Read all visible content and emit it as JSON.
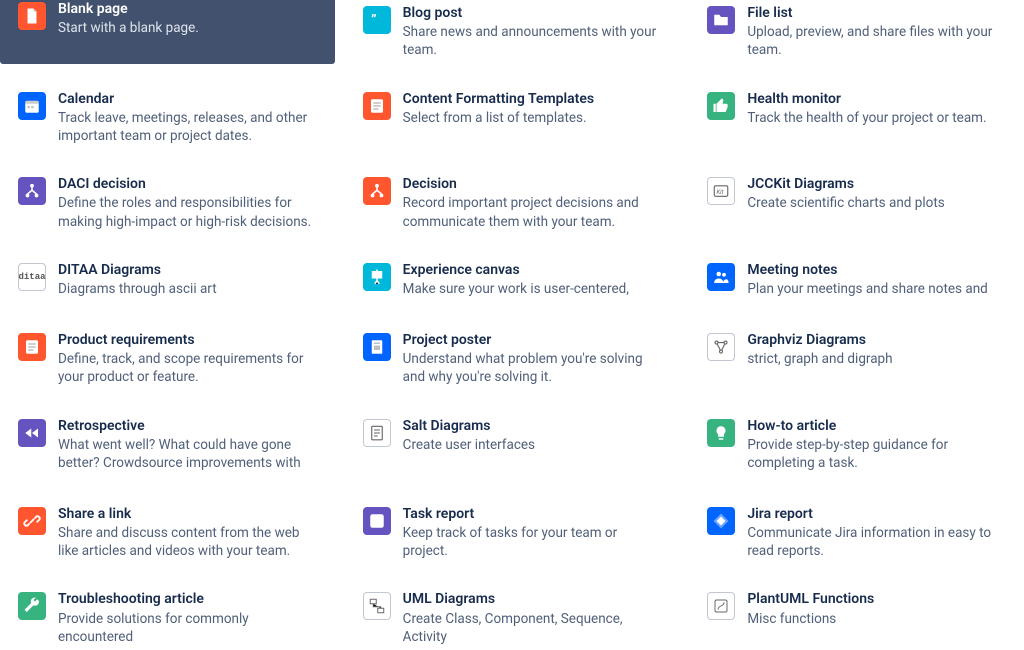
{
  "templates": [
    {
      "id": "blank-page",
      "title": "Blank page",
      "desc": "Start with a blank page.",
      "icon": "doc",
      "bg": "#FF5630",
      "fg": "#fff",
      "selected": true
    },
    {
      "id": "blog-post",
      "title": "Blog post",
      "desc": "Share news and announcements with your team.",
      "icon": "quote",
      "bg": "#00B8D9",
      "fg": "#fff"
    },
    {
      "id": "file-list",
      "title": "File list",
      "desc": "Upload, preview, and share files with your team.",
      "icon": "folder",
      "bg": "#6554C0",
      "fg": "#fff"
    },
    {
      "id": "calendar",
      "title": "Calendar",
      "desc": "Track leave, meetings, releases, and other important team or project dates.",
      "icon": "calendar",
      "bg": "#0065FF",
      "fg": "#fff"
    },
    {
      "id": "content-formatting",
      "title": "Content Formatting Templates",
      "desc": "Select from a list of templates.",
      "icon": "list-doc",
      "bg": "#FF5630",
      "fg": "#fff"
    },
    {
      "id": "health-monitor",
      "title": "Health monitor",
      "desc": "Track the health of your project or team.",
      "icon": "thumb",
      "bg": "#36B37E",
      "fg": "#fff"
    },
    {
      "id": "daci",
      "title": "DACI decision",
      "desc": "Define the roles and responsibilities for making high-impact or high-risk decisions.",
      "icon": "branch",
      "bg": "#6554C0",
      "fg": "#fff"
    },
    {
      "id": "decision",
      "title": "Decision",
      "desc": "Record important project decisions and communicate them with your team.",
      "icon": "branch",
      "bg": "#FF5630",
      "fg": "#fff"
    },
    {
      "id": "jcckit",
      "title": "JCCKit Diagrams",
      "desc": "Create scientific charts and plots",
      "icon": "kit",
      "outline": true
    },
    {
      "id": "ditaa",
      "title": "DITAA Diagrams",
      "desc": "Diagrams through ascii art",
      "icon": "ditaa",
      "outline": true
    },
    {
      "id": "experience-canvas",
      "title": "Experience canvas",
      "desc": "Make sure your work is user-centered,",
      "icon": "easel",
      "bg": "#00B8D9",
      "fg": "#fff"
    },
    {
      "id": "meeting-notes",
      "title": "Meeting notes",
      "desc": "Plan your meetings and share notes and",
      "icon": "people",
      "bg": "#0065FF",
      "fg": "#fff"
    },
    {
      "id": "product-req",
      "title": "Product requirements",
      "desc": "Define, track, and scope requirements for your product or feature.",
      "icon": "list-doc",
      "bg": "#FF5630",
      "fg": "#fff"
    },
    {
      "id": "project-poster",
      "title": "Project poster",
      "desc": "Understand what problem you're solving and why you're solving it.",
      "icon": "poster",
      "bg": "#0065FF",
      "fg": "#fff"
    },
    {
      "id": "graphviz",
      "title": "Graphviz Diagrams",
      "desc": "strict, graph and digraph",
      "icon": "graph",
      "outline": true
    },
    {
      "id": "retro",
      "title": "Retrospective",
      "desc": "What went well? What could have gone better? Crowdsource improvements with your",
      "icon": "rewind",
      "bg": "#6554C0",
      "fg": "#fff"
    },
    {
      "id": "salt",
      "title": "Salt Diagrams",
      "desc": "Create user interfaces",
      "icon": "doc-lines",
      "outline": true
    },
    {
      "id": "howto",
      "title": "How-to article",
      "desc": "Provide step-by-step guidance for completing a task.",
      "icon": "bulb",
      "bg": "#36B37E",
      "fg": "#fff"
    },
    {
      "id": "share-link",
      "title": "Share a link",
      "desc": "Share and discuss content from the web like articles and videos with your team.",
      "icon": "link",
      "bg": "#FF5630",
      "fg": "#fff"
    },
    {
      "id": "task-report",
      "title": "Task report",
      "desc": "Keep track of tasks for your team or project.",
      "icon": "check",
      "bg": "#6554C0",
      "fg": "#fff"
    },
    {
      "id": "jira-report",
      "title": "Jira report",
      "desc": "Communicate Jira information in easy to read reports.",
      "icon": "jira",
      "bg": "#0065FF",
      "fg": "#fff"
    },
    {
      "id": "troubleshoot",
      "title": "Troubleshooting article",
      "desc": "Provide solutions for commonly encountered",
      "icon": "wrench",
      "bg": "#36B37E",
      "fg": "#fff"
    },
    {
      "id": "uml",
      "title": "UML Diagrams",
      "desc": "Create Class, Component, Sequence, Activity",
      "icon": "uml",
      "outline": true
    },
    {
      "id": "plantuml",
      "title": "PlantUML Functions",
      "desc": "Misc functions",
      "icon": "func",
      "outline": true
    }
  ]
}
